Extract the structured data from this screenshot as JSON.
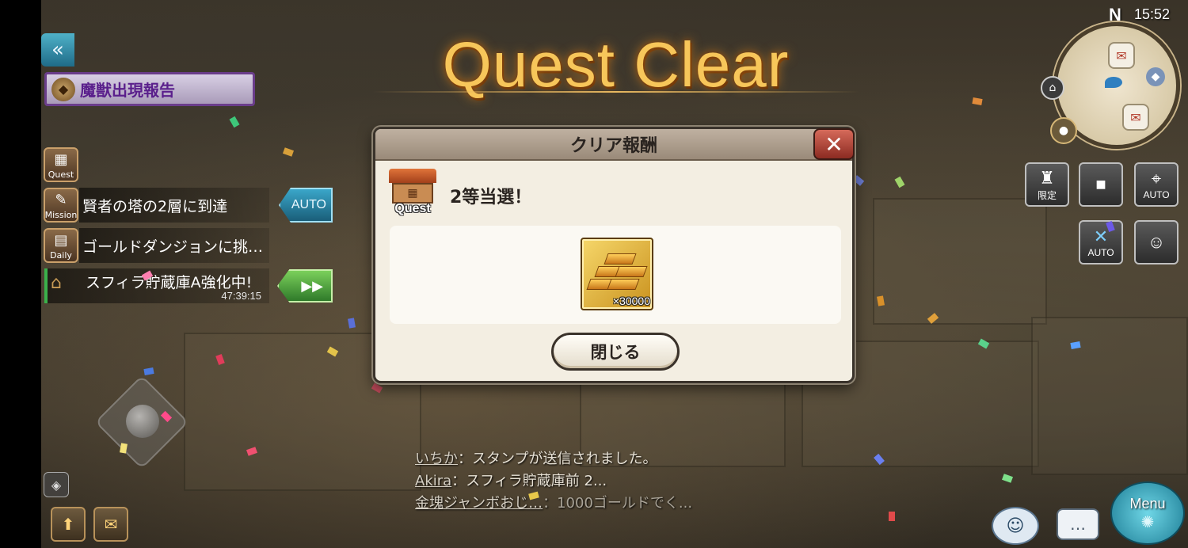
{
  "title": "Quest Clear",
  "clock": "15:52",
  "north_label": "N",
  "colors": {
    "title_gold": "#f7c65a",
    "back_button": "#2b87a3",
    "auto_button": "#2585a8",
    "ff_button": "#4aa53a"
  },
  "left_panel": {
    "monster_report": "魔獣出現報告",
    "side_icons": {
      "quest": "Quest",
      "mission": "Mission",
      "daily": "Daily"
    },
    "tasks": {
      "mission": "賢者の塔の2層に到達",
      "daily": "ゴールドダンジョンに挑…"
    },
    "auto_label": "AUTO",
    "storage": {
      "name": "スフィラ貯蔵庫A強化中!",
      "timer": "47:39:15"
    }
  },
  "right_panel": {
    "limited_label": "限定",
    "auto_label": "AUTO",
    "auto_label_2": "AUTO",
    "menu_label": "Menu"
  },
  "dialog": {
    "header": "クリア報酬",
    "badge": "Quest",
    "prize": "2等当選！",
    "reward_qty": "×30000",
    "close_button": "閉じる"
  },
  "chat": {
    "lines": [
      {
        "who": "いちか",
        "text": "：スタンプが送信されました。"
      },
      {
        "who": "Akira",
        "text": "：スフィラ貯蔵庫前 2..."
      },
      {
        "who": "金塊ジャンボおじ…",
        "text": "：1000ゴールドでく..."
      }
    ]
  }
}
